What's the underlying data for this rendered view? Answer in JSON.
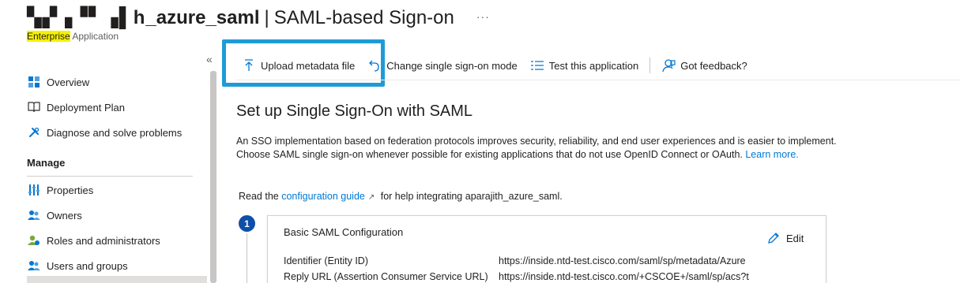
{
  "header": {
    "title_obscured": "▚▞▗▝▘▗▌h",
    "title_app": "_azure_saml",
    "title_separator": "|",
    "title_page": "SAML-based Sign-on",
    "more_label": "···",
    "subtitle_highlight": "Enterprise",
    "subtitle_rest": " Application"
  },
  "sidebar": {
    "collapse_label": "«",
    "items": [
      {
        "label": "Overview",
        "icon": "overview-grid-icon"
      },
      {
        "label": "Deployment Plan",
        "icon": "book-icon"
      },
      {
        "label": "Diagnose and solve problems",
        "icon": "wrench-icon"
      }
    ],
    "section_label": "Manage",
    "manage_items": [
      {
        "label": "Properties",
        "icon": "properties-icon"
      },
      {
        "label": "Owners",
        "icon": "owners-icon"
      },
      {
        "label": "Roles and administrators",
        "icon": "roles-icon"
      },
      {
        "label": "Users and groups",
        "icon": "users-groups-icon"
      }
    ]
  },
  "toolbar": {
    "upload": "Upload metadata file",
    "change": "Change single sign-on mode",
    "test": "Test this application",
    "feedback": "Got feedback?"
  },
  "main": {
    "title": "Set up Single Sign-On with SAML",
    "description": "An SSO implementation based on federation protocols improves security, reliability, and end user experiences and is easier to implement. Choose SAML single sign-on whenever possible for existing applications that do not use OpenID Connect or OAuth. ",
    "learn_more": "Learn more.",
    "guide_prefix": "Read the ",
    "guide_link": "configuration guide",
    "guide_suffix": " for help integrating aparajith_azure_saml.",
    "step_number": "1"
  },
  "card": {
    "title": "Basic SAML Configuration",
    "edit_label": "Edit",
    "rows": [
      {
        "label": "Identifier (Entity ID)",
        "value": "https://inside.ntd-test.cisco.com/saml/sp/metadata/Azure"
      },
      {
        "label": "Reply URL (Assertion Consumer Service URL)",
        "value": "https://inside.ntd-test.cisco.com/+CSCOE+/saml/sp/acs?t"
      }
    ]
  },
  "colors": {
    "accent": "#0078d4",
    "highlight_box": "#1e9bd7",
    "step_circle": "#0f4fa8",
    "subtitle_highlight": "#f7f000"
  }
}
